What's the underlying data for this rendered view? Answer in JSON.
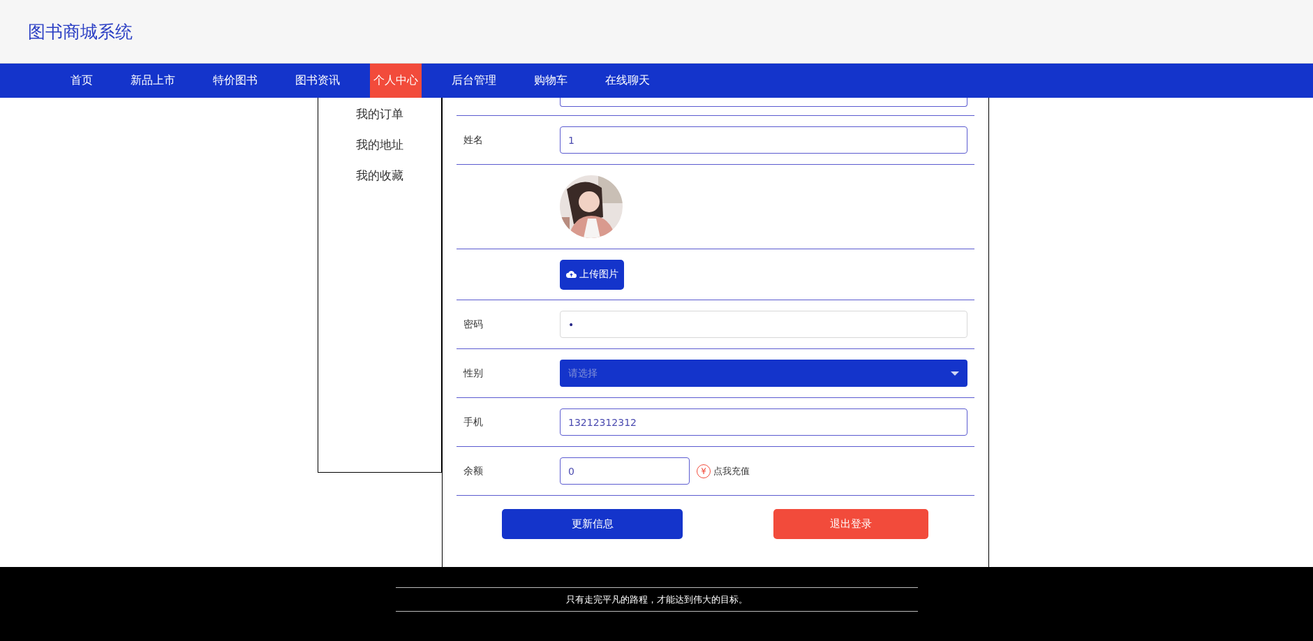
{
  "header": {
    "title": "图书商城系统"
  },
  "nav": [
    {
      "label": "首页",
      "selected": false
    },
    {
      "label": "新品上市",
      "selected": false
    },
    {
      "label": "特价图书",
      "selected": false
    },
    {
      "label": "图书资讯",
      "selected": false
    },
    {
      "label": "个人中心",
      "selected": true
    },
    {
      "label": "后台管理",
      "selected": false
    },
    {
      "label": "购物车",
      "selected": false
    },
    {
      "label": "在线聊天",
      "selected": false
    }
  ],
  "sidebar": {
    "items": [
      {
        "label": "我的订单"
      },
      {
        "label": "我的地址"
      },
      {
        "label": "我的收藏"
      }
    ]
  },
  "form": {
    "rows": [
      {
        "kind": "partial"
      },
      {
        "kind": "input",
        "label": "姓名",
        "value": "1"
      },
      {
        "kind": "avatar"
      },
      {
        "kind": "upload",
        "button": "上传图片"
      },
      {
        "kind": "password",
        "label": "密码",
        "value": "•"
      },
      {
        "kind": "select",
        "label": "性别",
        "placeholder": "请选择"
      },
      {
        "kind": "input",
        "label": "手机",
        "value": "13212312312"
      },
      {
        "kind": "balance",
        "label": "余额",
        "value": "0",
        "icon": "¥",
        "link": "点我充值"
      }
    ],
    "buttons": [
      {
        "label": "更新信息",
        "kind": "primary"
      },
      {
        "label": "退出登录",
        "kind": "danger"
      }
    ]
  },
  "footer": {
    "motto": "只有走完平凡的路程，才能达到伟大的目标。"
  }
}
